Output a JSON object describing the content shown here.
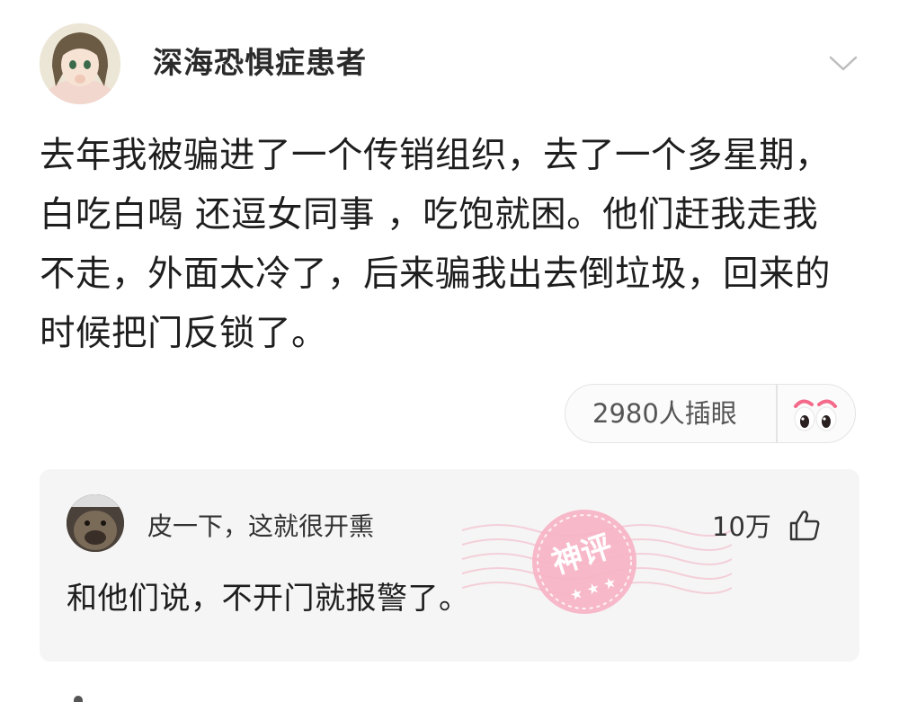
{
  "post": {
    "author": "深海恐惧症患者",
    "content": "去年我被骗进了一个传销组织，去了一个多星期， 白吃白喝 还逗女同事 ，吃饱就困。他们赶我走我不走，外面太冷了，后来骗我出去倒垃圾，回来的时候把门反锁了。",
    "reaction_label": "2980人插眼",
    "menu_icon": "chevron-down-icon",
    "reaction_icon": "eyes-icon"
  },
  "hot_comment": {
    "username": "皮一下，这就很开熏",
    "likes": "10万",
    "text": "和他们说，不开门就报警了。",
    "badge": "神评",
    "like_icon": "thumbs-up-icon"
  },
  "colors": {
    "background": "#ffffff",
    "card": "#f5f5f5",
    "badge_pink": "#f4a9bd",
    "text_primary": "#1e1e1e"
  }
}
